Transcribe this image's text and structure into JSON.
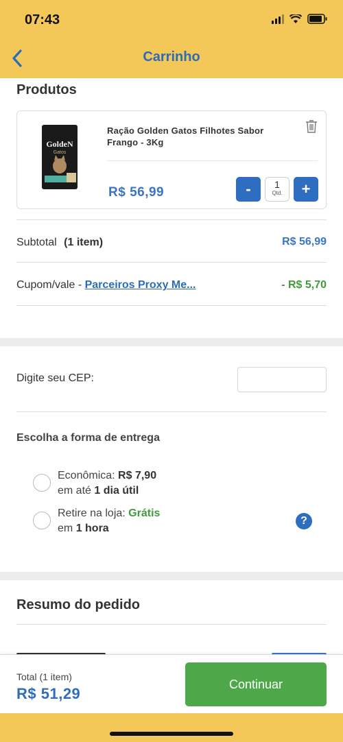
{
  "status_bar": {
    "time": "07:43"
  },
  "nav": {
    "title": "Carrinho"
  },
  "products": {
    "title": "Produtos",
    "items": [
      {
        "name": "Ração Golden Gatos Filhotes Sabor Frango - 3Kg",
        "price": "R$  56,99",
        "quantity": "1",
        "quantity_label": "Qtd.",
        "image_brand": "GoldeN",
        "image_sub": "Gatos"
      }
    ],
    "minus_label": "-",
    "plus_label": "+"
  },
  "subtotal": {
    "label": "Subtotal",
    "count": "(1 item)",
    "value": "R$  56,99"
  },
  "coupon": {
    "label": "Cupom/vale -",
    "link": "Parceiros Proxy Me...",
    "value": "- R$   5,70"
  },
  "cep": {
    "label": "Digite seu CEP:",
    "value": ""
  },
  "delivery": {
    "title": "Escolha a forma de entrega",
    "options": [
      {
        "prefix": "Econômica:",
        "price": "R$  7,90",
        "line2_prefix": "em até",
        "line2_bold": "1 dia útil"
      },
      {
        "prefix": "Retire na loja:",
        "price": "Grátis",
        "line2_prefix": "em",
        "line2_bold": "1 hora"
      }
    ],
    "help": "?"
  },
  "summary": {
    "title": "Resumo do pedido"
  },
  "footer": {
    "total_label": "Total (1 item)",
    "total_value": "R$  51,29",
    "continue": "Continuar"
  },
  "colors": {
    "brand_yellow": "#F4C858",
    "primary_blue": "#2F6DC0",
    "success_green": "#4EA84A"
  }
}
